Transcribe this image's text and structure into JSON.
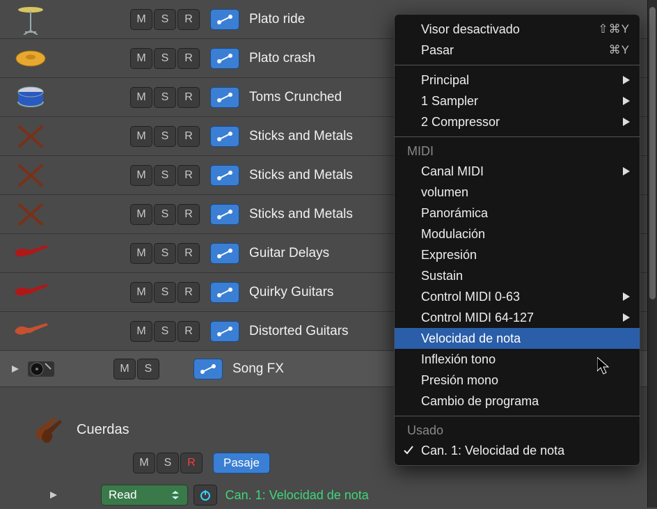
{
  "buttons": {
    "M": "M",
    "S": "S",
    "R": "R"
  },
  "tracks": [
    {
      "name": "Plato ride",
      "icon": "cymbal-stand"
    },
    {
      "name": "Plato crash",
      "icon": "cymbal"
    },
    {
      "name": "Toms Crunched",
      "icon": "tom"
    },
    {
      "name": "Sticks and Metals",
      "icon": "sticks"
    },
    {
      "name": "Sticks and Metals",
      "icon": "sticks"
    },
    {
      "name": "Sticks and Metals",
      "icon": "sticks"
    },
    {
      "name": "Guitar Delays",
      "icon": "guitar-red"
    },
    {
      "name": "Quirky Guitars",
      "icon": "guitar-red"
    },
    {
      "name": "Distorted Guitars",
      "icon": "guitar"
    },
    {
      "name": "Song FX",
      "icon": "turntable",
      "no_r": true,
      "disclosure": true
    }
  ],
  "footer": {
    "group_title": "Cuerdas",
    "read": "Read",
    "passage": "Pasaje",
    "automation_label": "Can. 1: Velocidad de nota"
  },
  "menu": {
    "top": [
      {
        "label": "Visor desactivado",
        "shortcut": "⇧⌘Y"
      },
      {
        "label": "Pasar",
        "shortcut": "⌘Y"
      }
    ],
    "plugins": [
      {
        "label": "Principal",
        "submenu": true
      },
      {
        "label": "1 Sampler",
        "submenu": true
      },
      {
        "label": "2 Compressor",
        "submenu": true
      }
    ],
    "midi_header": "MIDI",
    "midi": [
      {
        "label": "Canal MIDI",
        "submenu": true
      },
      {
        "label": "volumen"
      },
      {
        "label": "Panorámica"
      },
      {
        "label": "Modulación"
      },
      {
        "label": "Expresión"
      },
      {
        "label": "Sustain"
      },
      {
        "label": "Control MIDI 0-63",
        "submenu": true
      },
      {
        "label": "Control MIDI 64-127",
        "submenu": true
      },
      {
        "label": "Velocidad de nota",
        "highlight": true
      },
      {
        "label": "Inflexión tono"
      },
      {
        "label": "Presión mono"
      },
      {
        "label": "Cambio de programa"
      }
    ],
    "used_header": "Usado",
    "used": [
      {
        "label": "Can. 1: Velocidad de nota",
        "checked": true
      }
    ]
  }
}
